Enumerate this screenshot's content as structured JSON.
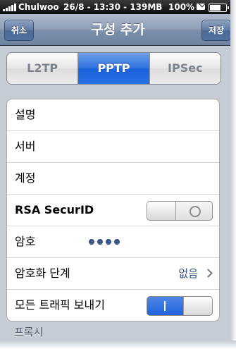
{
  "status_bar": {
    "carrier": "Chulwoo",
    "info": "26/8 - 13:30 - 139MB",
    "battery": "100%"
  },
  "nav": {
    "title": "구성 추가",
    "cancel_label": "취소",
    "save_label": "저장"
  },
  "segments": [
    {
      "label": "L2TP",
      "selected": false
    },
    {
      "label": "PPTP",
      "selected": true
    },
    {
      "label": "IPSec",
      "selected": false
    }
  ],
  "rows": {
    "description": "설명",
    "server": "서버",
    "account": "계정",
    "rsa": "RSA SecurID",
    "rsa_on": false,
    "password": "암호",
    "password_mask_count": 4,
    "encryption_label": "암호화 단계",
    "encryption_value": "없음",
    "send_all_traffic": "모든 트래픽 보내기",
    "send_all_on": true
  },
  "section_proxy": "프록시",
  "colors": {
    "nav_bar": "#7d90aa",
    "selected_segment": "#2a6fe2",
    "value_text": "#385487",
    "background": "#c5ccd4"
  }
}
